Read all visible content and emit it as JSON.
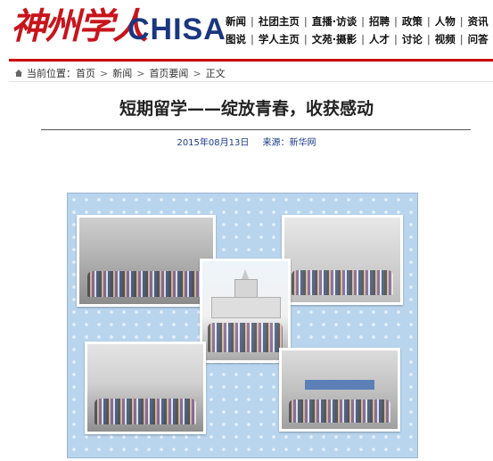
{
  "header": {
    "logo_cn": "神州学人",
    "logo_en": "CHISA",
    "nav_row1": [
      "新闻",
      "社团主页",
      "直播·访谈",
      "招聘",
      "政策",
      "人物",
      "资讯"
    ],
    "nav_row2": [
      "图说",
      "学人主页",
      "文苑·摄影",
      "人才",
      "讨论",
      "视频",
      "问答"
    ]
  },
  "breadcrumb": {
    "prefix": "当前位置：首页",
    "items": [
      "新闻",
      "首页要闻",
      "正文"
    ]
  },
  "article": {
    "title": "短期留学——绽放青春，收获感动",
    "date": "2015年08月13日",
    "source": "来源：新华网"
  },
  "colors": {
    "brand_red": "#c8141c",
    "brand_blue": "#1a3680",
    "meta_blue": "#1a3b8c",
    "collage_bg": "#b9d5ee"
  },
  "icons": {
    "breadcrumb": "home-icon"
  }
}
